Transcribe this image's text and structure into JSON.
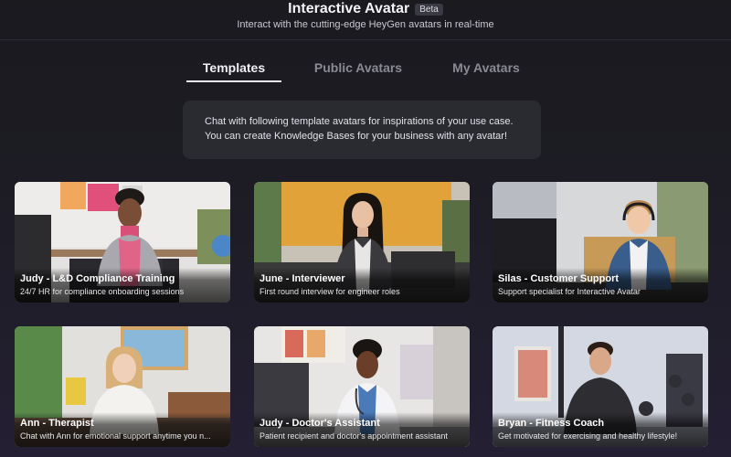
{
  "header": {
    "title": "Interactive Avatar",
    "badge": "Beta",
    "subtitle": "Interact with the cutting-edge HeyGen avatars in real-time"
  },
  "tabs": [
    {
      "label": "Templates",
      "active": true
    },
    {
      "label": "Public Avatars",
      "active": false
    },
    {
      "label": "My Avatars",
      "active": false
    }
  ],
  "info": {
    "line1": "Chat with following template avatars for inspirations of your use case.",
    "line2": "You can create Knowledge Bases for your business with any avatar!"
  },
  "cards": [
    {
      "name": "Judy - L&D Compliance Training",
      "desc": "24/7 HR for compliance onboarding sessions"
    },
    {
      "name": "June - Interviewer",
      "desc": "First round interview for engineer roles"
    },
    {
      "name": "Silas - Customer Support",
      "desc": "Support specialist for Interactive Avatar"
    },
    {
      "name": "Ann - Therapist",
      "desc": "Chat with Ann for emotional support anytime you n..."
    },
    {
      "name": "Judy - Doctor's Assistant",
      "desc": "Patient recipient and doctor's appointment assistant"
    },
    {
      "name": "Bryan - Fitness Coach",
      "desc": "Get motivated for exercising and healthy lifestyle!"
    }
  ],
  "colors": {
    "background": "#1c1c22",
    "info_box": "#2a2a31",
    "tab_active": "#f0f0f4",
    "tab_inactive": "#8a8a94"
  }
}
